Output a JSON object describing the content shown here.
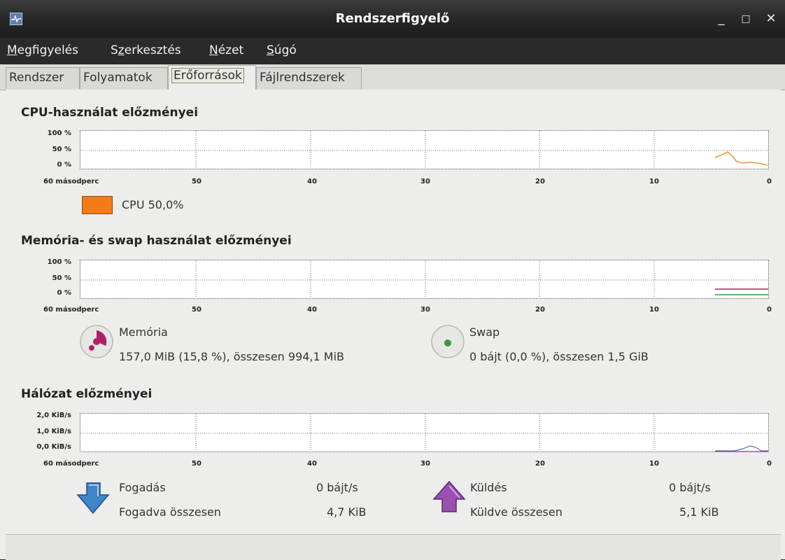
{
  "window": {
    "title": "Rendszerfigyelő",
    "minimize": "_",
    "maximize": "□",
    "close": "✕"
  },
  "menu": [
    {
      "label_u": "M",
      "label_rest": "egfigyelés"
    },
    {
      "label_pre": "S",
      "label_u": "z",
      "label_rest": "erkesztés"
    },
    {
      "label_u": "N",
      "label_rest": "ézet"
    },
    {
      "label_u": "S",
      "label_rest": "úgó"
    }
  ],
  "tabs": [
    "Rendszer",
    "Folyamatok",
    "Erőforrások",
    "Fájlrendszerek"
  ],
  "cpu": {
    "title": "CPU-használat előzményei",
    "y_labels": [
      "100 %",
      "50 %",
      "0 %"
    ],
    "x_labels": [
      "60 másodperc",
      "50",
      "40",
      "30",
      "20",
      "10",
      "0"
    ],
    "legend": "CPU 50,0%",
    "color": "#f47b16"
  },
  "memory": {
    "title": "Memória- és swap használat előzményei",
    "y_labels": [
      "100 %",
      "50 %",
      "0 %"
    ],
    "x_labels": [
      "60 másodperc",
      "50",
      "40",
      "30",
      "20",
      "10",
      "0"
    ],
    "mem_label": "Memória",
    "mem_value": "157,0 MiB (15,8 %), összesen 994,1 MiB",
    "mem_color": "#b0206a",
    "swap_label": "Swap",
    "swap_value": "0 bájt (0,0 %), összesen 1,5 GiB",
    "swap_color": "#3a9a3a"
  },
  "network": {
    "title": "Hálózat előzményei",
    "y_labels": [
      "2,0 KiB/s",
      "1,0 KiB/s",
      "0,0 KiB/s"
    ],
    "x_labels": [
      "60 másodperc",
      "50",
      "40",
      "30",
      "20",
      "10",
      "0"
    ],
    "recv_label": "Fogadás",
    "recv_rate": "0 bájt/s",
    "recv_total_label": "Fogadva összesen",
    "recv_total": "4,7 KiB",
    "send_label": "Küldés",
    "send_rate": "0 bájt/s",
    "send_total_label": "Küldve összesen",
    "send_total": "5,1 KiB"
  }
}
